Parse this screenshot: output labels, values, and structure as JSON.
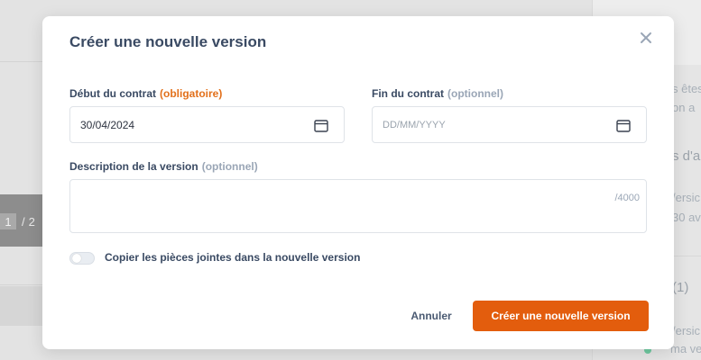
{
  "background": {
    "pager": {
      "current": "1",
      "separator": "/",
      "total": "2"
    },
    "right_panel": {
      "line1": "s êtes",
      "line2": "on a",
      "heading": "s d'a",
      "item1": "/ersic",
      "item2": "30 av",
      "count": "(1)",
      "item3": "/ersic",
      "item4": "ma ve"
    }
  },
  "modal": {
    "title": "Créer une nouvelle version",
    "close_icon": "close-icon",
    "start_date": {
      "label": "Début du contrat",
      "tag": "(obligatoire)",
      "value": "30/04/2024",
      "icon": "calendar-icon"
    },
    "end_date": {
      "label": "Fin du contrat",
      "tag": "(optionnel)",
      "placeholder": "DD/MM/YYYY",
      "icon": "calendar-icon"
    },
    "description": {
      "label": "Description de la version",
      "tag": "(optionnel)",
      "counter": "/4000"
    },
    "copy_attachments": {
      "label": "Copier les pièces jointes dans la nouvelle version",
      "enabled": false
    },
    "cancel_label": "Annuler",
    "submit_label": "Créer une nouvelle version"
  },
  "colors": {
    "accent": "#e35d0d",
    "required": "#e2701b",
    "optional": "#9aa6b6",
    "title": "#3a4a63"
  }
}
